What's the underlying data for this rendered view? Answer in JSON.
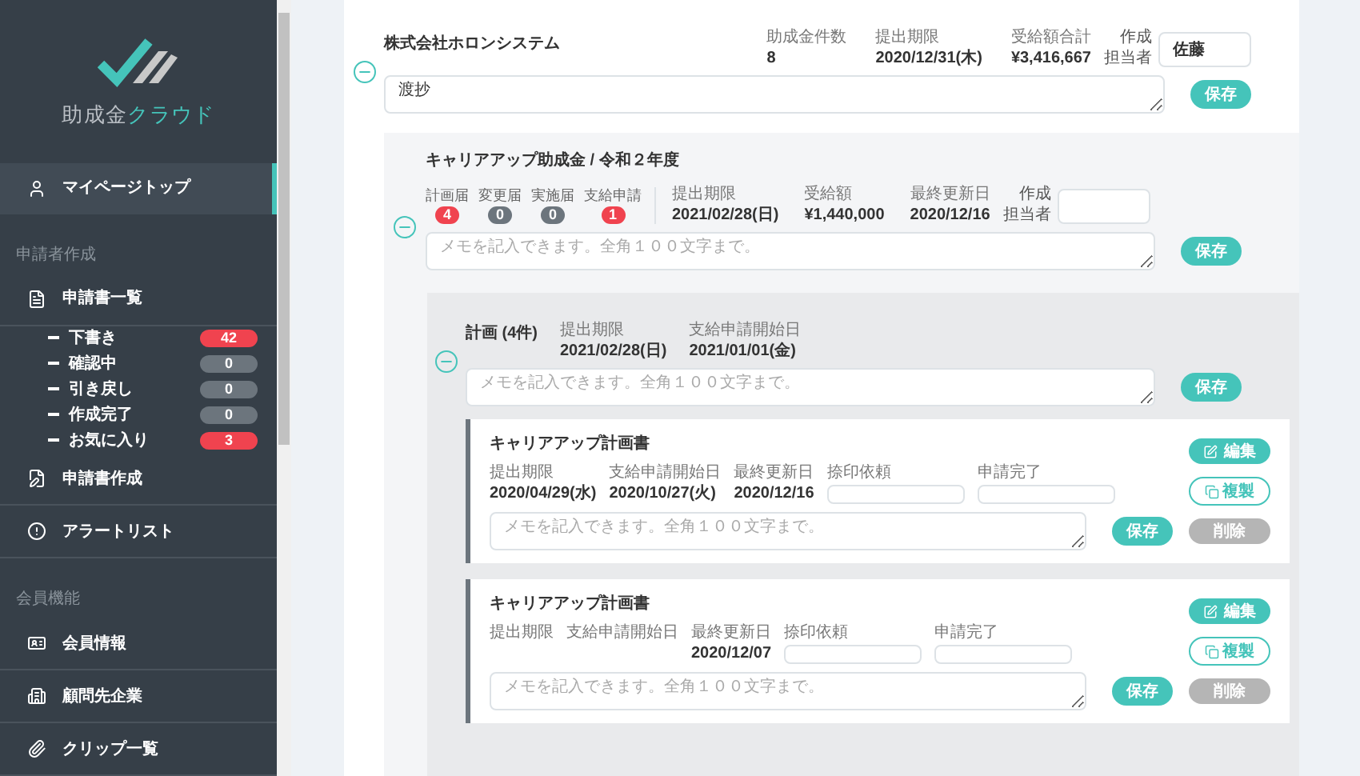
{
  "sidebar": {
    "logo": {
      "brand": "助成金",
      "brand_accent": "クラウド"
    },
    "items": [
      {
        "kind": "link",
        "label": "マイページトップ",
        "selected": true
      },
      {
        "kind": "header",
        "label": "申請者作成"
      },
      {
        "kind": "link",
        "label": "申請書一覧",
        "selected": false
      },
      {
        "kind": "sub",
        "label": "下書き",
        "count": "42",
        "color": "#f0434f"
      },
      {
        "kind": "sub",
        "label": "確認中",
        "count": "0",
        "color": "#6c757d"
      },
      {
        "kind": "sub",
        "label": "引き戻し",
        "count": "0",
        "color": "#6c757d"
      },
      {
        "kind": "sub",
        "label": "作成完了",
        "count": "0",
        "color": "#6c757d"
      },
      {
        "kind": "sub",
        "label": "お気に入り",
        "count": "3",
        "color": "#f0434f"
      },
      {
        "kind": "link",
        "label": "申請書作成",
        "selected": false
      },
      {
        "kind": "link",
        "label": "アラートリスト",
        "selected": false
      },
      {
        "kind": "header",
        "label": "会員機能"
      },
      {
        "kind": "link",
        "label": "会員情報",
        "selected": false
      },
      {
        "kind": "link",
        "label": "顧問先企業",
        "selected": false
      },
      {
        "kind": "link",
        "label": "クリップ一覧",
        "selected": false
      }
    ]
  },
  "company": {
    "expanded": true,
    "name": "株式会社ホロンシステム",
    "stats": [
      {
        "label": "助成金件数",
        "value": "8"
      },
      {
        "label": "提出期限",
        "value": "2020/12/31(木)"
      },
      {
        "label": "受給額合計",
        "value": "¥3,416,667"
      }
    ],
    "owner_label": [
      "作成",
      "担当者"
    ],
    "owner": "佐藤",
    "memo": "渡抄",
    "save": "保存"
  },
  "subsidy": {
    "expanded": true,
    "title": "キャリアアップ助成金 / 令和２年度",
    "status_counts": [
      {
        "label": "計画届",
        "count": "4",
        "color": "#f0434f"
      },
      {
        "label": "変更届",
        "count": "0",
        "color": "#6c757d"
      },
      {
        "label": "実施届",
        "count": "0",
        "color": "#6c757d"
      },
      {
        "label": "支給申請",
        "count": "1",
        "color": "#f0434f"
      }
    ],
    "stats": [
      {
        "label": "提出期限",
        "value": "2021/02/28(日)"
      },
      {
        "label": "受給額",
        "value": "¥1,440,000"
      },
      {
        "label": "最終更新日",
        "value": "2020/12/16"
      }
    ],
    "owner_label": [
      "作成",
      "担当者"
    ],
    "memo_placeholder": "メモを記入できます。全角１００文字まで。",
    "save": "保存"
  },
  "plan": {
    "expanded": true,
    "title": "計画 (4件)",
    "stats": [
      {
        "label": "提出期限",
        "value": "2021/02/28(日)"
      },
      {
        "label": "支給申請開始日",
        "value": "2021/01/01(金)"
      }
    ],
    "memo_placeholder": "メモを記入できます。全角１００文字まで。",
    "save": "保存"
  },
  "documents": [
    {
      "title": "キャリアアップ計画書",
      "stats": [
        {
          "label": "提出期限",
          "value": "2020/04/29(水)"
        },
        {
          "label": "支給申請開始日",
          "value": "2020/10/27(火)"
        },
        {
          "label": "最終更新日",
          "value": "2020/12/16"
        }
      ],
      "fields": [
        "捺印依頼",
        "申請完了"
      ],
      "memo_placeholder": "メモを記入できます。全角１００文字まで。",
      "save": "保存",
      "actions": [
        {
          "kind": "edit",
          "label": "編集"
        },
        {
          "kind": "copy",
          "label": "複製"
        },
        {
          "kind": "delete",
          "label": "削除"
        }
      ]
    },
    {
      "title": "キャリアアップ計画書",
      "stats": [
        {
          "label": "提出期限"
        },
        {
          "label": "支給申請開始日"
        },
        {
          "label": "最終更新日",
          "value": "2020/12/07"
        }
      ],
      "fields": [
        "捺印依頼",
        "申請完了"
      ],
      "memo_placeholder": "メモを記入できます。全角１００文字まで。",
      "save": "保存",
      "actions": [
        {
          "kind": "edit",
          "label": "編集"
        },
        {
          "kind": "copy",
          "label": "複製"
        },
        {
          "kind": "delete",
          "label": "削除"
        }
      ]
    }
  ]
}
